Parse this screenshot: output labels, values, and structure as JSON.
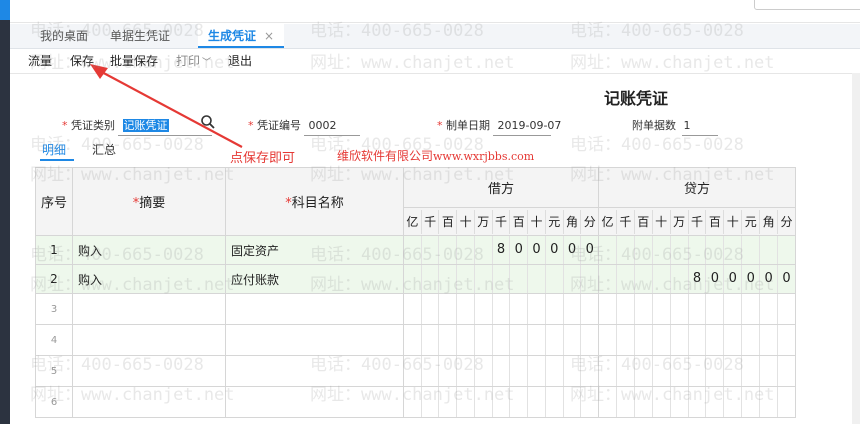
{
  "tabs": [
    {
      "label": "我的桌面"
    },
    {
      "label": "单据生凭证"
    },
    {
      "label": "生成凭证",
      "close": "×"
    }
  ],
  "toolbar": {
    "flow": "流量",
    "save": "保存",
    "batch_save": "批量保存",
    "print": "打印",
    "exit": "退出"
  },
  "voucher": {
    "title": "记账凭证",
    "type_label": "凭证类别",
    "type_value": "记账凭证",
    "number_label": "凭证编号",
    "number_value": "0002",
    "date_label": "制单日期",
    "date_value": "2019-09-07",
    "attach_label": "附单据数",
    "attach_value": "1"
  },
  "subtabs": {
    "detail": "明细",
    "summary": "汇总"
  },
  "table": {
    "headers": {
      "seq": "序号",
      "summary": "摘要",
      "account": "科目名称",
      "debit": "借方",
      "credit": "贷方"
    },
    "digits": [
      "亿",
      "千",
      "百",
      "十",
      "万",
      "千",
      "百",
      "十",
      "元",
      "角",
      "分"
    ],
    "rows": [
      {
        "seq": "1",
        "summary": "购入",
        "account": "固定资产",
        "debit": [
          "",
          "",
          "",
          "",
          "",
          "8",
          "0",
          "0",
          "0",
          "0",
          "0"
        ],
        "credit": [
          "",
          "",
          "",
          "",
          "",
          "",
          "",
          "",
          "",
          "",
          ""
        ]
      },
      {
        "seq": "2",
        "summary": "购入",
        "account": "应付账款",
        "debit": [
          "",
          "",
          "",
          "",
          "",
          "",
          "",
          "",
          "",
          "",
          ""
        ],
        "credit": [
          "",
          "",
          "",
          "",
          "",
          "8",
          "0",
          "0",
          "0",
          "0",
          "0"
        ]
      }
    ],
    "blank_rows": [
      "3",
      "4",
      "5",
      "6"
    ]
  },
  "annotation": {
    "hint": "点保存即可",
    "brand": "维欣软件有限公司",
    "url": "www.wxrjbbs.com"
  },
  "watermark": {
    "phone": "电话：400-665-0028",
    "site": "网址：www.chanjet.net"
  },
  "colors": {
    "accent": "#1e88e5",
    "annotation": "#e53935",
    "row_highlight": "#eef8ec"
  }
}
